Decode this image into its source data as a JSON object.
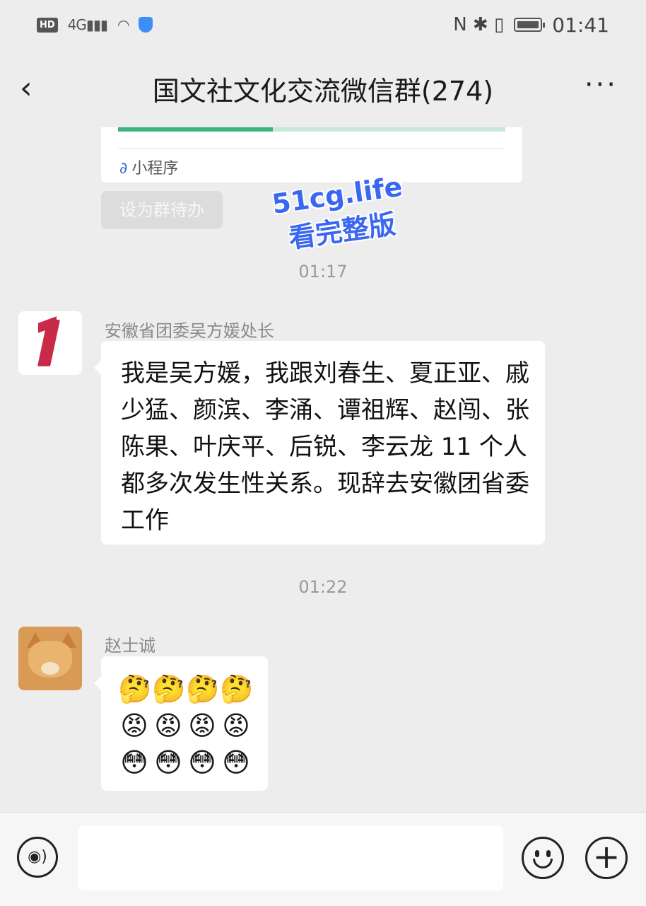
{
  "status_bar": {
    "hd": "HD",
    "signal": "4G",
    "time": "01:41",
    "right_icons": "N ✱ ▯"
  },
  "header": {
    "back_icon": "‹",
    "title": "国文社文化交流微信群(274)",
    "more_icon": "···"
  },
  "mini_program": {
    "label": "小程序",
    "icon": "link-icon"
  },
  "todo_button": "设为群待办",
  "watermark": {
    "line1": "51cg.life",
    "line2": "看完整版"
  },
  "messages": [
    {
      "time": "01:17",
      "sender": "安徽省团委吴方媛处长",
      "text": "我是吴方媛，我跟刘春生、夏正亚、戚少猛、颜滨、李涌、谭祖辉、赵闯、张陈果、叶庆平、后锐、李云龙 11 个人都多次发生性关系。现辞去安徽团省委工作"
    },
    {
      "time": "01:22",
      "sender": "赵士诚",
      "emoji_rows": [
        [
          "🤔",
          "🤔",
          "🤔",
          "🤔"
        ],
        [
          "😡",
          "😡",
          "😡",
          "😡"
        ],
        [
          "😳",
          "😳",
          "😳",
          "😳"
        ]
      ],
      "question_mark": "?"
    }
  ],
  "input_bar": {
    "voice_icon": "voice-icon",
    "emoji_icon": "emoji-face-icon",
    "plus_icon": "+",
    "input_value": ""
  },
  "colors": {
    "accent_blue": "#3a67f0",
    "progress_green": "#3bb37e",
    "background": "#ededed"
  }
}
